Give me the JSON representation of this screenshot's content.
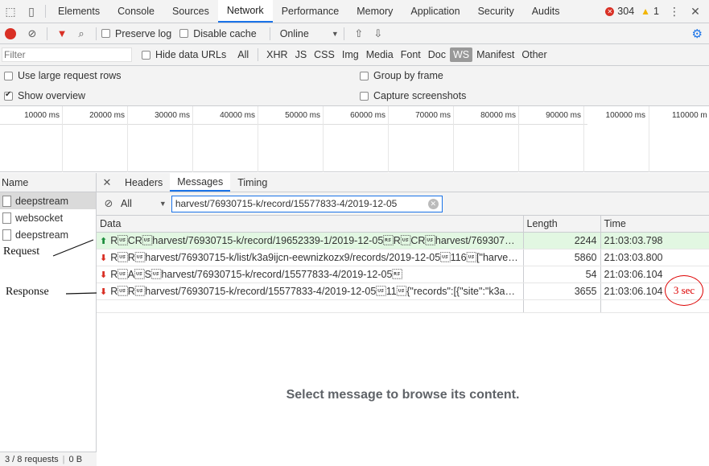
{
  "tabs": [
    "Elements",
    "Console",
    "Sources",
    "Network",
    "Performance",
    "Memory",
    "Application",
    "Security",
    "Audits"
  ],
  "active_tab": "Network",
  "status": {
    "errors": "304",
    "warnings": "1"
  },
  "toolbar": {
    "preserve_log": "Preserve log",
    "disable_cache": "Disable cache",
    "throttle": "Online"
  },
  "filter": {
    "placeholder": "Filter",
    "hide_data_urls": "Hide data URLs",
    "types": [
      "All",
      "XHR",
      "JS",
      "CSS",
      "Img",
      "Media",
      "Font",
      "Doc",
      "WS",
      "Manifest",
      "Other"
    ],
    "active_type": "WS"
  },
  "options": {
    "large_rows": "Use large request rows",
    "show_overview": "Show overview",
    "group_by_frame": "Group by frame",
    "capture_screenshots": "Capture screenshots"
  },
  "overview_ticks": [
    "10000 ms",
    "20000 ms",
    "30000 ms",
    "40000 ms",
    "50000 ms",
    "60000 ms",
    "70000 ms",
    "80000 ms",
    "90000 ms",
    "100000 ms",
    "110000 m"
  ],
  "requests": {
    "header": "Name",
    "items": [
      "deepstream",
      "websocket",
      "deepstream"
    ],
    "status_summary": "3 / 8 requests",
    "status_size": "0 B"
  },
  "detail": {
    "tabs": [
      "Headers",
      "Messages",
      "Timing"
    ],
    "active_tab": "Messages",
    "filter_select": "All",
    "filter_value": "harvest/76930715-k/record/15577833-4/2019-12-05",
    "columns": [
      "Data",
      "Length",
      "Time"
    ],
    "messages": [
      {
        "dir": "sent",
        "data": "R\u001fCR\u001fharvest/76930715-k/record/19652339-1/2019-12-05\u001eR\u001fCR\u001fharvest/76930715-k/record/...",
        "length": "2244",
        "time": "21:03:03.798"
      },
      {
        "dir": "recv",
        "data": "R\u001fR\u001fharvest/76930715-k/list/k3a9ijcn-eewnizkozx9/records/2019-12-05\u001f116\u001f[\"harvest/769...",
        "length": "5860",
        "time": "21:03:03.800"
      },
      {
        "dir": "recv",
        "data": "R\u001fA\u001fS\u001fharvest/76930715-k/record/15577833-4/2019-12-05\u001e",
        "length": "54",
        "time": "21:03:06.104"
      },
      {
        "dir": "recv",
        "data": "R\u001fR\u001fharvest/76930715-k/record/15577833-4/2019-12-05\u001f11\u001f{\"records\":[{\"site\":\"k3a9ijcn-ee...",
        "length": "3655",
        "time": "21:03:06.104"
      }
    ],
    "empty_text": "Select message to browse its content."
  },
  "annotations": {
    "request": "Request",
    "response": "Response",
    "delay": "3  sec"
  }
}
